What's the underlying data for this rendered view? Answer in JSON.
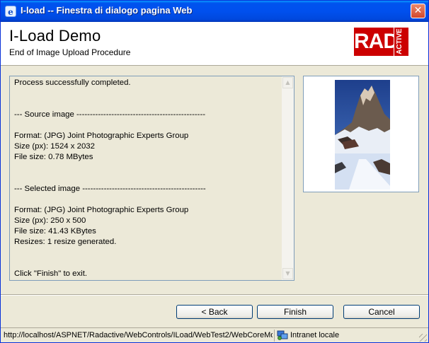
{
  "window": {
    "title": "I-load -- Finestra di dialogo pagina Web",
    "close_glyph": "✕"
  },
  "header": {
    "title": "I-Load Demo",
    "subtitle": "End of Image Upload Procedure",
    "logo": {
      "main": "RAD",
      "side": "ACTIVE"
    }
  },
  "report": {
    "lines": [
      "Process successfully completed.",
      "",
      "",
      "--- Source image ------------------------------------------------",
      "",
      "Format: (JPG) Joint Photographic Experts Group",
      "Size (px): 1524 x 2032",
      "File size: 0.78 MBytes",
      "",
      "",
      "--- Selected image ----------------------------------------------",
      "",
      "Format: (JPG) Joint Photographic Experts Group",
      "Size (px): 250 x 500",
      "File size: 41.43 KBytes",
      "Resizes: 1 resize generated.",
      "",
      "",
      "Click \"Finish\" to exit."
    ]
  },
  "buttons": {
    "back": "< Back",
    "finish": "Finish",
    "cancel": "Cancel"
  },
  "status": {
    "url": "http://localhost/ASPNET/Radactive/WebControls/ILoad/WebTest2/WebCoreMo",
    "zone": "Intranet locale"
  },
  "icons": {
    "window": "ie-icon",
    "zone": "intranet-zone-icon"
  },
  "colors": {
    "titlebar": "#0054e3",
    "logo": "#cc0000",
    "dialog_bg": "#ece9d8"
  }
}
